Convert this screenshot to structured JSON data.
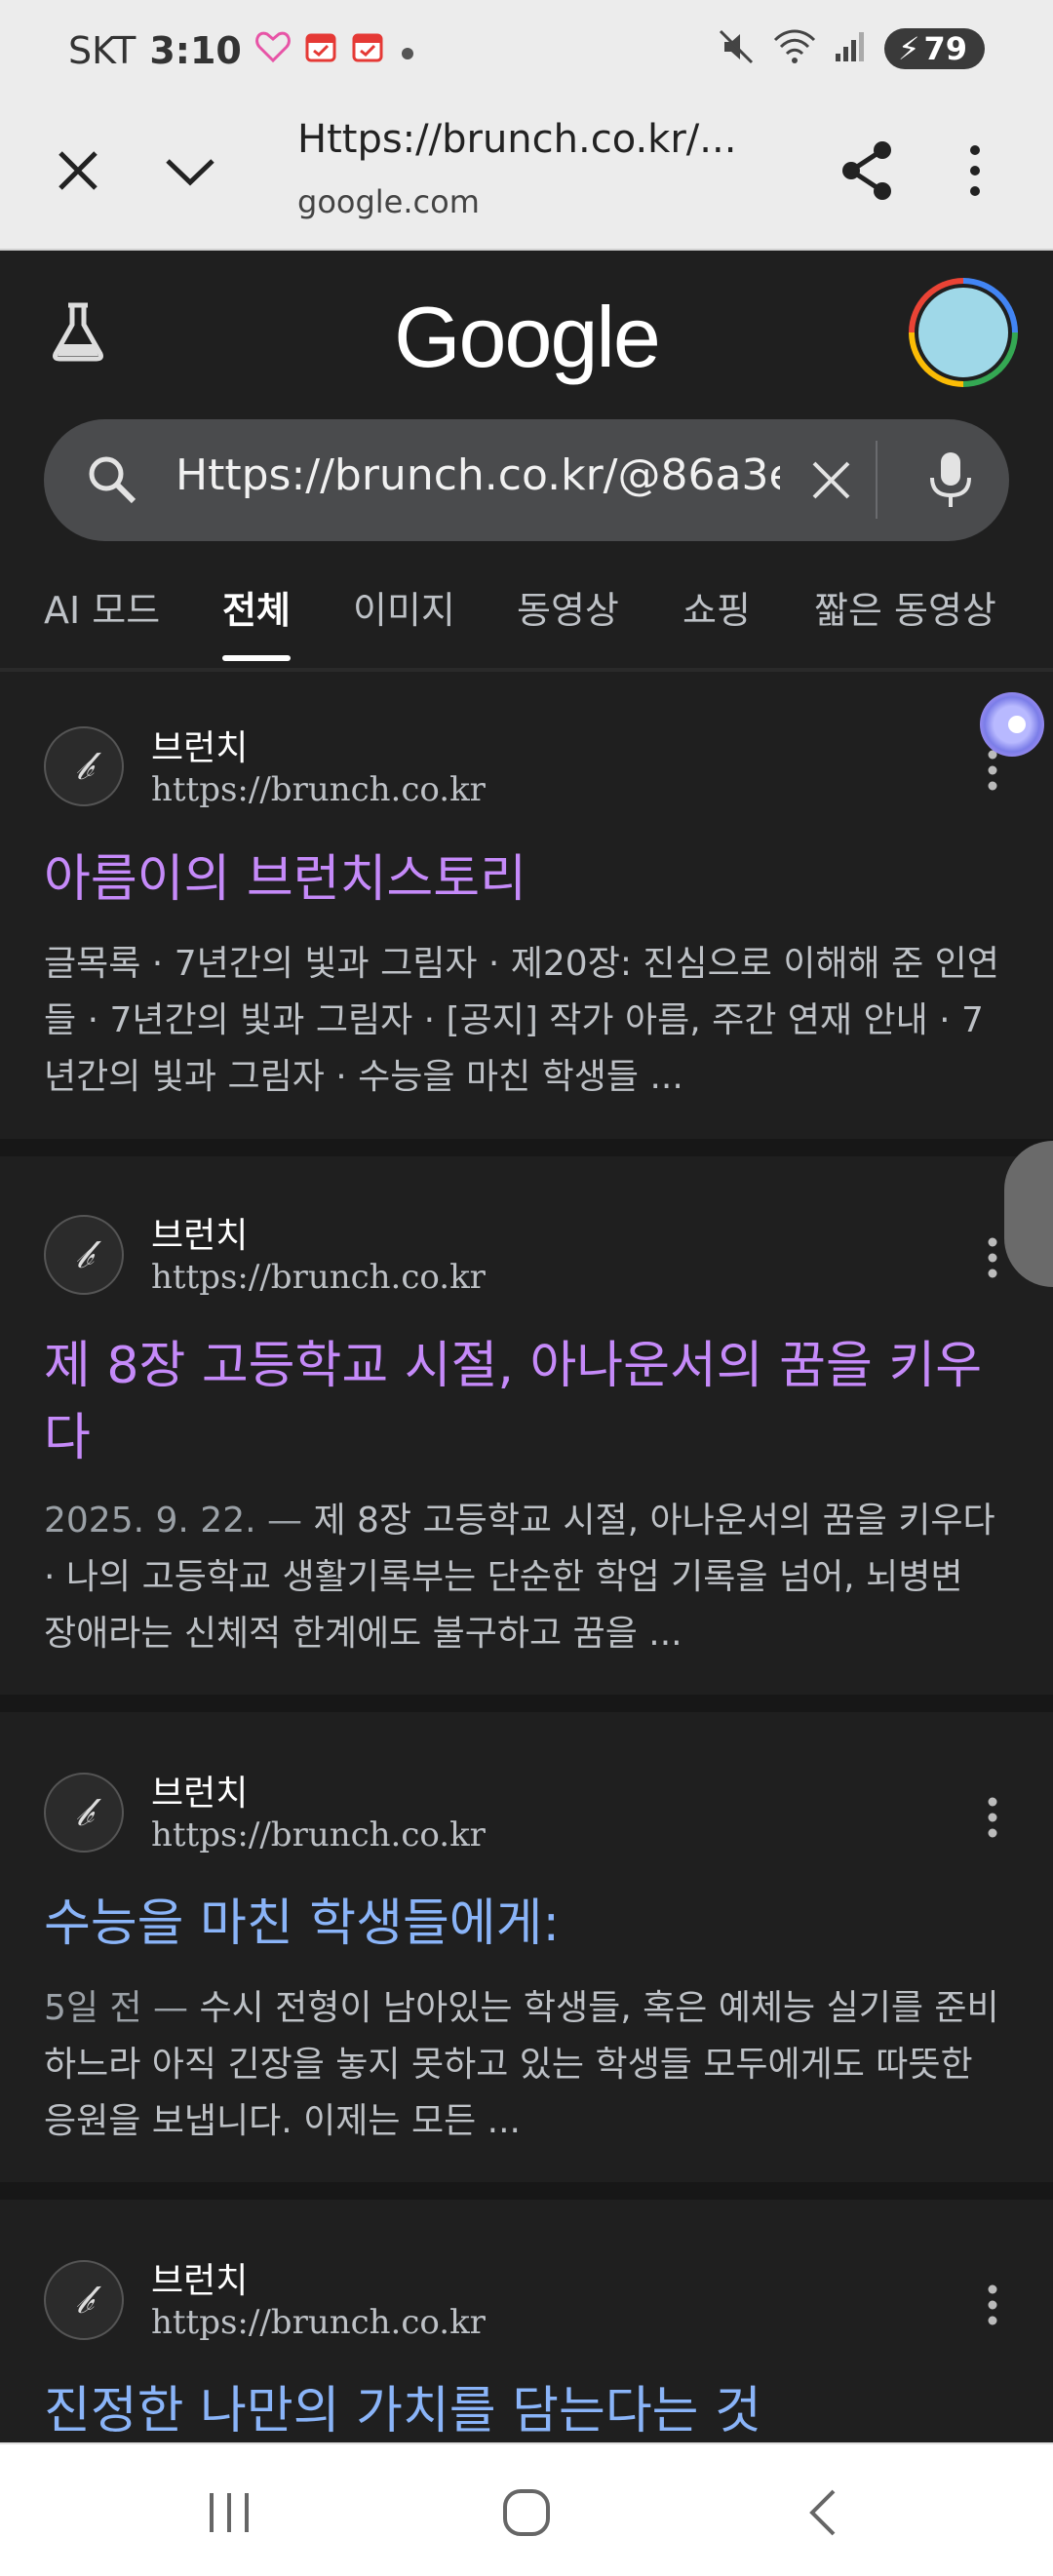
{
  "status_bar": {
    "carrier": "SKT",
    "time": "3:10",
    "battery": "79"
  },
  "browser": {
    "url_title": "Https://brunch.co.kr/...",
    "domain": "google.com"
  },
  "google": {
    "logo": "Google",
    "query": "Https://brunch.co.kr/@86a3e",
    "tabs": [
      "AI 모드",
      "전체",
      "이미지",
      "동영상",
      "쇼핑",
      "짧은 동영상"
    ],
    "active_tab": "전체"
  },
  "results": [
    {
      "site": "브런치",
      "url": "https://brunch.co.kr",
      "title": "아름이의 브런치스토리",
      "visited": true,
      "snippet_lines": [
        "글목록 · 7년간의 빛과 그림자 · 제20장: 진심으로 이해해 준 인연",
        "들 · 7년간의 빛과 그림자 · [공지] 작가 아름, 주간 연재 안내 · 7",
        "년간의 빛과 그림자 · 수능을 마친 학생들 ..."
      ]
    },
    {
      "site": "브런치",
      "url": "https://brunch.co.kr",
      "title_lines": [
        "제 8장 고등학교 시절, 아나운서의 꿈을 키우",
        "다"
      ],
      "visited": true,
      "date": "2025. 9. 22. —",
      "snippet_lines": [
        " 제 8장 고등학교 시절, 아나운서의 꿈을 키우다",
        "· 나의 고등학교 생활기록부는 단순한 학업 기록을 넘어, 뇌병변",
        "장애라는 신체적 한계에도 불구하고 꿈을 ..."
      ]
    },
    {
      "site": "브런치",
      "url": "https://brunch.co.kr",
      "title": "수능을 마친 학생들에게:",
      "visited": false,
      "date": "5일 전 —",
      "snippet_lines": [
        " 수시 전형이 남아있는 학생들, 혹은 예체능 실기를 준비",
        "하느라 아직 긴장을 놓지 못하고 있는 학생들 모두에게도 따뜻한",
        "응원을 보냅니다. 이제는 모든 ..."
      ]
    },
    {
      "site": "브런치",
      "url": "https://brunch.co.kr",
      "title": "진정한 나만의 가치를 담는다는 것",
      "visited": false
    }
  ],
  "colors": {
    "visited_link": "#c58af9",
    "link": "#8ab4f8",
    "background": "#1f1f1f"
  }
}
